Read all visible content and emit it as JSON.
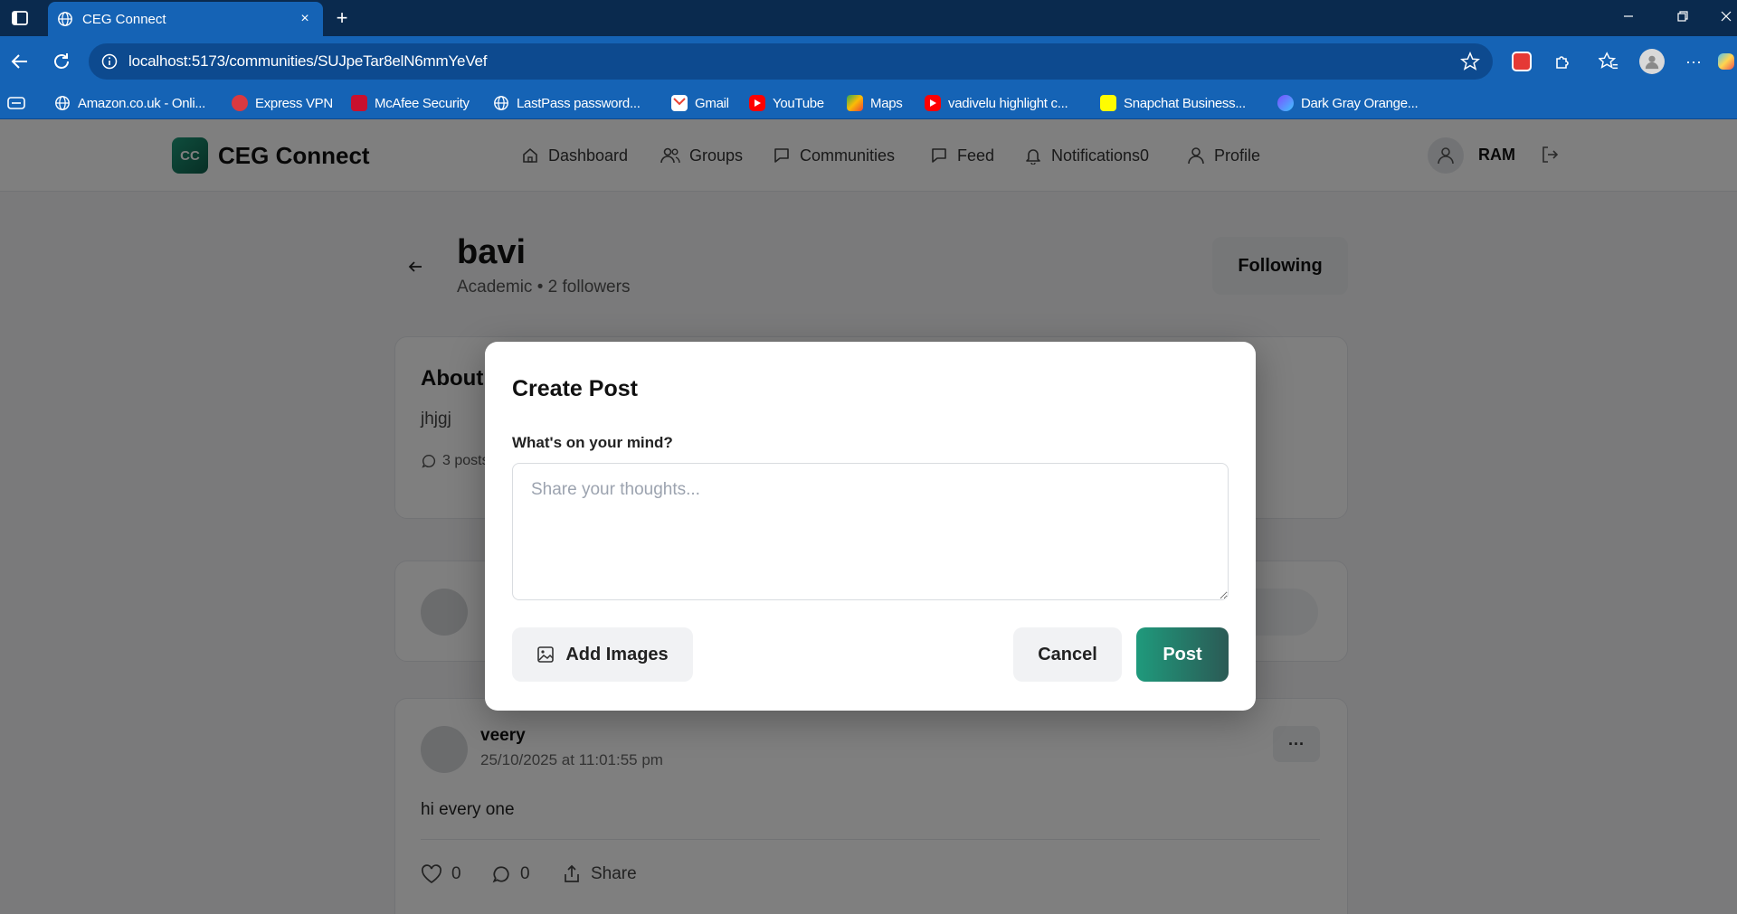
{
  "browser": {
    "tab_title": "CEG Connect",
    "tab_close": "×",
    "new_tab": "+",
    "url": "localhost:5173/communities/SUJpeTar8elN6mmYeVef",
    "more": "···",
    "bookmarks": [
      {
        "label": "Amazon.co.uk - Onli...",
        "icon": "globe-icon"
      },
      {
        "label": "Express VPN",
        "icon": "expressvpn-icon"
      },
      {
        "label": "McAfee Security",
        "icon": "mcafee-icon"
      },
      {
        "label": "LastPass password...",
        "icon": "globe-icon"
      },
      {
        "label": "Gmail",
        "icon": "gmail-icon"
      },
      {
        "label": "YouTube",
        "icon": "youtube-icon"
      },
      {
        "label": "Maps",
        "icon": "maps-icon"
      },
      {
        "label": "vadivelu highlight c...",
        "icon": "youtube-icon"
      },
      {
        "label": "Snapchat Business...",
        "icon": "snapchat-icon"
      },
      {
        "label": "Dark Gray Orange...",
        "icon": "app-icon"
      }
    ]
  },
  "app": {
    "logo_badge": "CC",
    "logo_text": "CEG Connect",
    "nav": [
      {
        "label": "Dashboard",
        "icon": "home-icon"
      },
      {
        "label": "Groups",
        "icon": "users-icon"
      },
      {
        "label": "Communities",
        "icon": "chat-icon"
      },
      {
        "label": "Feed",
        "icon": "feed-icon"
      },
      {
        "label": "Notifications0",
        "icon": "bell-icon"
      },
      {
        "label": "Profile",
        "icon": "user-icon"
      }
    ],
    "user_name": "RAM"
  },
  "community": {
    "name": "bavi",
    "meta": "Academic • 2 followers",
    "follow_label": "Following",
    "about_title": "About",
    "about_desc": "jhjgj",
    "posts_count": "3 posts"
  },
  "post": {
    "author": "veery",
    "time": "25/10/2025 at 11:01:55 pm",
    "body": "hi every one",
    "more": "···",
    "likes": "0",
    "comments": "0",
    "share": "Share"
  },
  "modal": {
    "title": "Create Post",
    "label": "What's on your mind?",
    "placeholder": "Share your thoughts...",
    "add_images": "Add Images",
    "cancel": "Cancel",
    "post": "Post"
  },
  "colors": {
    "browser_dark": "#0a2a4e",
    "browser_blue": "#1563b5",
    "brand": "#1d9a7a"
  }
}
